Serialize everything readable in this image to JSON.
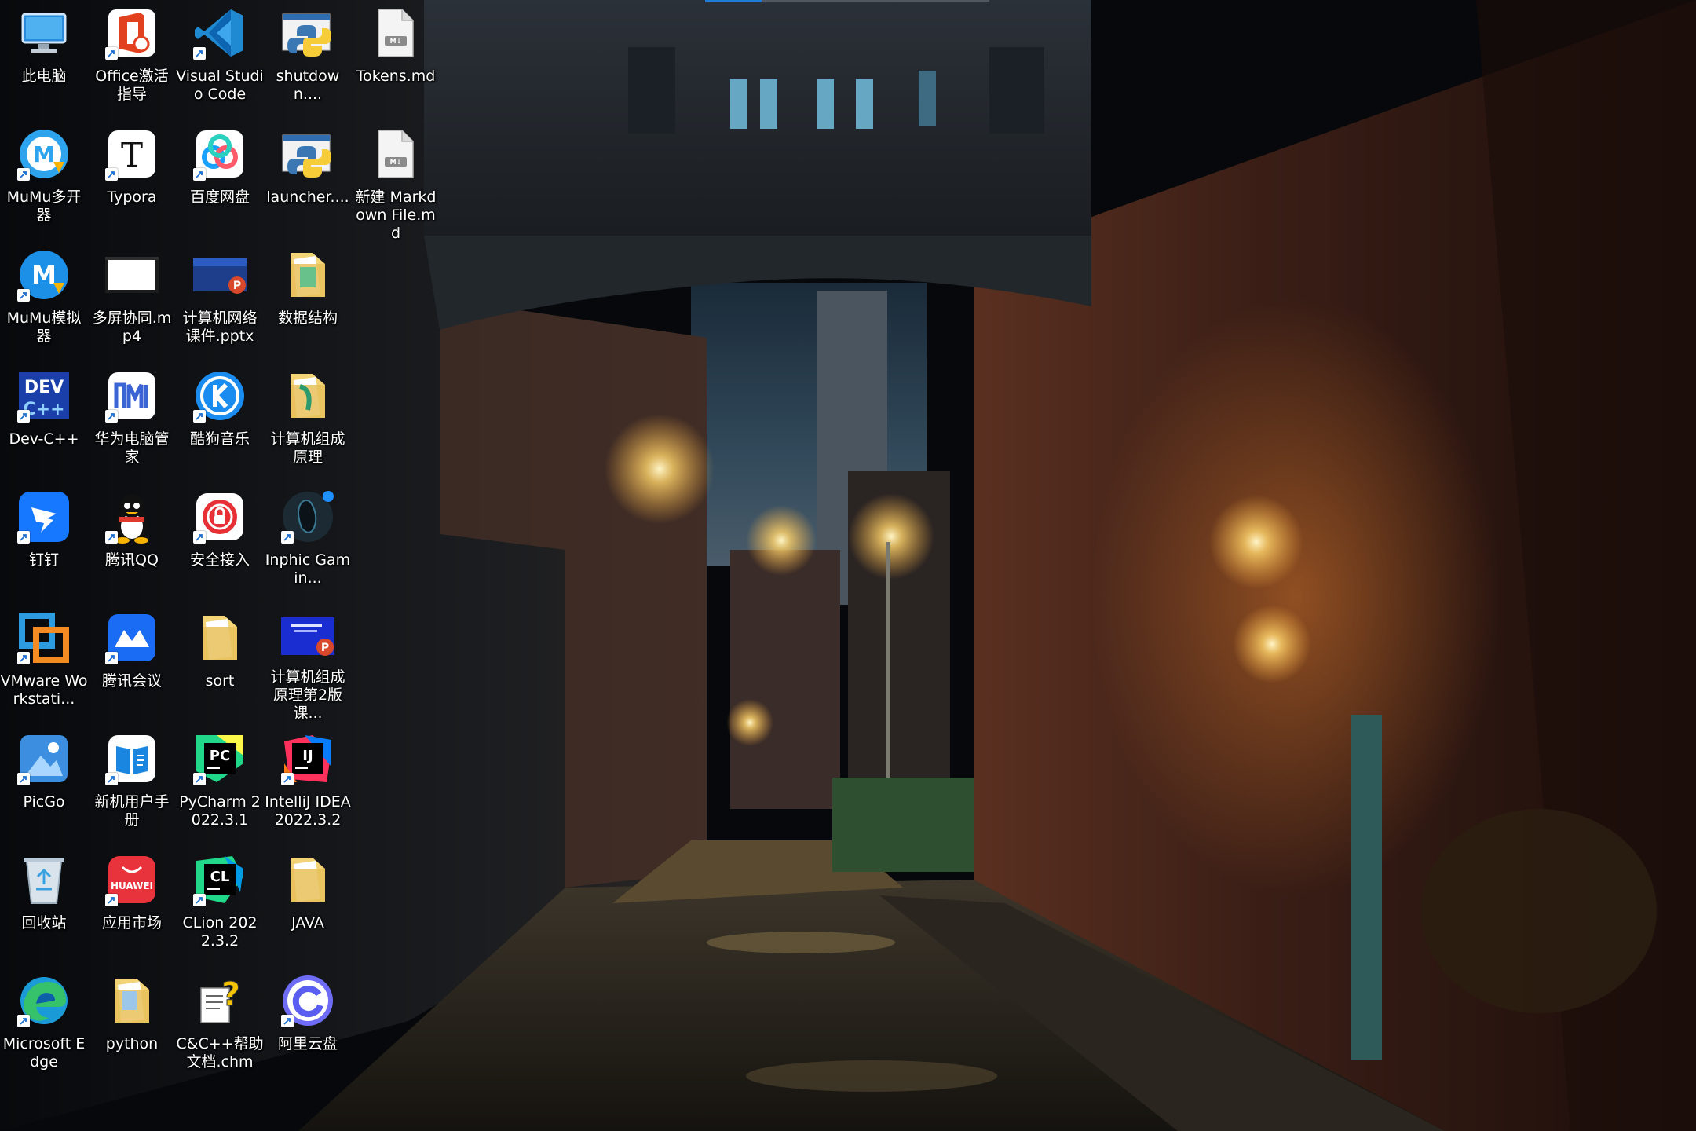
{
  "desktop": {
    "icons": [
      {
        "label": "此电脑",
        "icon": "computer-icon"
      },
      {
        "label": "Office激活指导",
        "icon": "office-activation-icon"
      },
      {
        "label": "Visual Studio Code",
        "icon": "vscode-icon"
      },
      {
        "label": "shutdown....",
        "icon": "python-file-icon"
      },
      {
        "label": "Tokens.md",
        "icon": "markdown-file-icon"
      },
      {
        "label": "MuMu多开器",
        "icon": "mumu-multi-icon"
      },
      {
        "label": "Typora",
        "icon": "typora-icon"
      },
      {
        "label": "百度网盘",
        "icon": "baidu-netdisk-icon"
      },
      {
        "label": "launcher....",
        "icon": "python-file-icon"
      },
      {
        "label": "新建 Markdown File.md",
        "icon": "markdown-file-icon"
      },
      {
        "label": "MuMu模拟器",
        "icon": "mumu-emulator-icon"
      },
      {
        "label": "多屏协同.mp4",
        "icon": "video-file-icon"
      },
      {
        "label": "计算机网络课件.pptx",
        "icon": "pptx-file-icon"
      },
      {
        "label": "数据结构",
        "icon": "folder-icon"
      },
      {
        "label": "Dev-C++",
        "icon": "devcpp-icon"
      },
      {
        "label": "华为电脑管家",
        "icon": "huawei-pc-manager-icon"
      },
      {
        "label": "酷狗音乐",
        "icon": "kugou-music-icon"
      },
      {
        "label": "计算机组成原理",
        "icon": "folder-icon"
      },
      {
        "label": "钉钉",
        "icon": "dingtalk-icon"
      },
      {
        "label": "腾讯QQ",
        "icon": "qq-icon"
      },
      {
        "label": "安全接入",
        "icon": "secure-access-icon"
      },
      {
        "label": "Inphic Gamin...",
        "icon": "inphic-mouse-icon"
      },
      {
        "label": "VMware Workstati...",
        "icon": "vmware-icon"
      },
      {
        "label": "腾讯会议",
        "icon": "tencent-meeting-icon"
      },
      {
        "label": "sort",
        "icon": "folder-icon"
      },
      {
        "label": "计算机组成原理第2版课...",
        "icon": "pptx-file-icon"
      },
      {
        "label": "PicGo",
        "icon": "picgo-icon"
      },
      {
        "label": "新机用户手册",
        "icon": "user-manual-icon"
      },
      {
        "label": "PyCharm 2022.3.1",
        "icon": "pycharm-icon"
      },
      {
        "label": "IntelliJ IDEA 2022.3.2",
        "icon": "intellij-icon"
      },
      {
        "label": "回收站",
        "icon": "recycle-bin-icon"
      },
      {
        "label": "应用市场",
        "icon": "huawei-appgallery-icon"
      },
      {
        "label": "CLion 2022.3.2",
        "icon": "clion-icon"
      },
      {
        "label": "JAVA",
        "icon": "folder-icon"
      },
      {
        "label": "Microsoft Edge",
        "icon": "edge-icon"
      },
      {
        "label": "python",
        "icon": "folder-icon"
      },
      {
        "label": "C&C++帮助文档.chm",
        "icon": "chm-help-icon"
      },
      {
        "label": "阿里云盘",
        "icon": "aliyun-drive-icon"
      }
    ]
  },
  "colors": {
    "label_text": "#ffffff",
    "accent": "#1e7bd9"
  }
}
